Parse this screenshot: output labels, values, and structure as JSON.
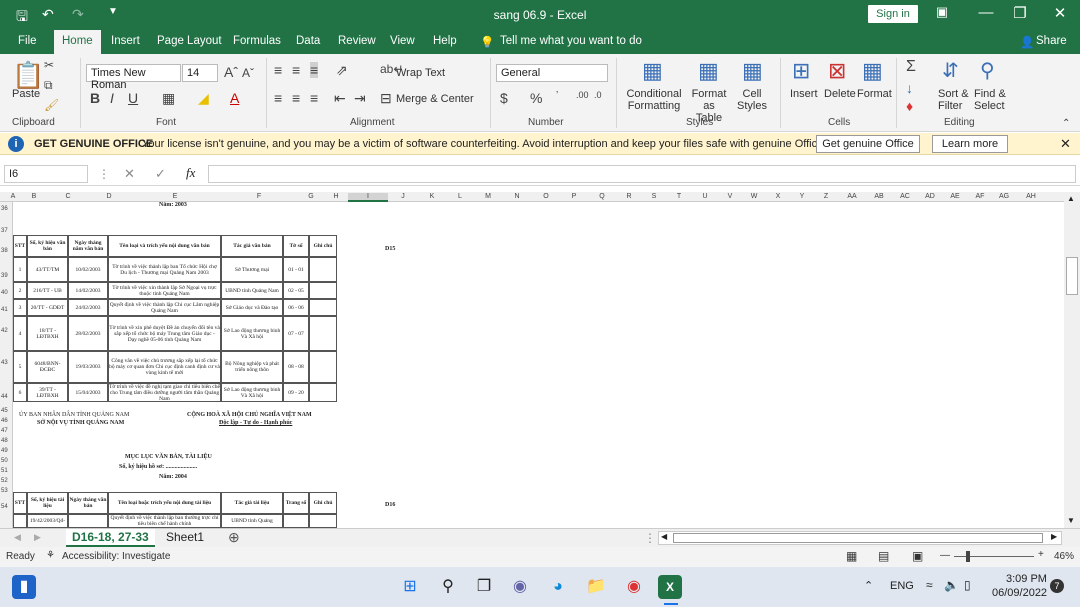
{
  "window": {
    "title": "sang 06.9  -  Excel",
    "sign_in": "Sign in"
  },
  "ribbon_tabs": [
    "File",
    "Home",
    "Insert",
    "Page Layout",
    "Formulas",
    "Data",
    "Review",
    "View",
    "Help"
  ],
  "tell_me": "Tell me what you want to do",
  "share": "Share",
  "ribbon": {
    "paste": "Paste",
    "clipboard": "Clipboard",
    "font_name": "Times New Roman",
    "font_size": "14",
    "font": "Font",
    "wrap_text": "Wrap Text",
    "merge_center": "Merge & Center",
    "alignment": "Alignment",
    "number_format": "General",
    "number": "Number",
    "conditional_formatting": [
      "Conditional",
      "Formatting"
    ],
    "format_as_table": [
      "Format as",
      "Table"
    ],
    "cell_styles": [
      "Cell",
      "Styles"
    ],
    "styles": "Styles",
    "insert": "Insert",
    "delete": "Delete",
    "format": "Format",
    "cells": "Cells",
    "sort_filter": [
      "Sort &",
      "Filter"
    ],
    "find_select": [
      "Find &",
      "Select"
    ],
    "editing": "Editing"
  },
  "message_bar": {
    "title": "GET GENUINE OFFICE",
    "text": "Your license isn't genuine, and you may be a victim of software counterfeiting. Avoid interruption and keep your files safe with genuine Office today.",
    "btn1": "Get genuine Office",
    "btn2": "Learn more"
  },
  "formula_bar": {
    "name_box": "I6",
    "formula": ""
  },
  "columns": [
    "A",
    "B",
    "C",
    "D",
    "E",
    "F",
    "G",
    "H",
    "I",
    "J",
    "K",
    "L",
    "M",
    "N",
    "O",
    "P",
    "Q",
    "R",
    "S",
    "T",
    "U",
    "V",
    "W",
    "X",
    "Y",
    "Z",
    "AA",
    "AB",
    "AC",
    "AD",
    "AE",
    "AF",
    "AG",
    "AH"
  ],
  "rows": [
    "36",
    "37",
    "38",
    "39",
    "40",
    "41",
    "42",
    "43",
    "44",
    "45",
    "46",
    "47",
    "48",
    "49",
    "50",
    "51",
    "52",
    "53",
    "54"
  ],
  "sheet": {
    "year_2003": "Năm: 2003",
    "headers": [
      "STT",
      "Số, ký hiệu văn bản",
      "Ngày tháng năm văn bản",
      "Tên loại và trích yếu nội dung văn bản",
      "Tác giả văn bản",
      "Tờ số",
      "Ghi chú"
    ],
    "d15": "D15",
    "records": [
      [
        "1",
        "43/TT/TM",
        "10/02/2003",
        "Tờ trình về việc thành lập ban Tổ chức Hội chợ Du lịch - Thương mại Quảng Nam 2003",
        "Sở Thương mại",
        "01 - 01",
        ""
      ],
      [
        "2",
        "216/TT - UB",
        "14/02/2003",
        "Tờ trình về việc xin thành lập Sở Ngoại vụ trực thuộc tỉnh Quảng Nam",
        "UBND tỉnh Quảng Nam",
        "02 - 05",
        ""
      ],
      [
        "3",
        "20/TT - GDĐT",
        "24/02/2003",
        "Quyết định về việc thành lập Chi cục Lâm nghiệp Quảng Nam",
        "Sở Giáo dục và Đào tạo",
        "06 - 06",
        ""
      ],
      [
        "4",
        "18/TT - LĐTBXH",
        "28/02/2003",
        "Tờ trình về xin phê duyệt Đề án chuyển đổi tên và sắp xếp tổ chức bộ máy Trung tâm Giáo dục - Dạy nghề 05-06 tỉnh Quảng Nam",
        "Sở Lao động thương binh Và Xã hội",
        "07 - 07",
        ""
      ],
      [
        "5",
        "6048/BNN-ĐCĐC",
        "19/03/2003",
        "Công văn về việc chủ trương sắp xếp lại tổ chức bộ máy cơ quan đơn Chi cục định canh định cư và vùng kinh tế mới",
        "Bộ Nông nghiệp và phát triển nông thôn",
        "08 - 08",
        ""
      ],
      [
        "6",
        "39/TT - LĐTBXH",
        "15/04/2003",
        "Tờ trình về việc đề nghị tạm giao chỉ tiêu biên chế cho Trung tâm điều dưỡng người tâm thần Quảng Nam",
        "Sở Lao động thương binh Và Xã hội",
        "09 - 20",
        ""
      ]
    ],
    "left_header": [
      "ỦY BAN NHÂN DÂN TỈNH QUẢNG NAM",
      "SỞ NỘI VỤ TỈNH QUẢNG NAM"
    ],
    "right_header": [
      "CỘNG HOÀ XÃ HỘI CHỦ NGHĨA VIỆT NAM",
      "Độc lập - Tự do - Hạnh phúc"
    ],
    "catalog_title": "MỤC LỤC VĂN BẢN, TÀI LIỆU",
    "file_no": "Số, ký hiệu hồ sơ: .....................",
    "year_2004": "Năm: 2004",
    "headers2": [
      "STT",
      "Số, ký hiệu tài liệu",
      "Ngày tháng văn bản",
      "Tên loại hoặc trích yếu nội dung tài liệu",
      "Tác giả tài liệu",
      "Trang số",
      "Ghi chú"
    ],
    "d16": "D16",
    "partial_row": [
      "",
      "19/42/2003/Qđ-",
      "",
      "Quyết định về việc thành lập ban thường trực chỉ tiêu biên chế hành chính",
      "UBND tỉnh Quảng",
      "",
      ""
    ]
  },
  "sheet_tabs": [
    "D16-18, 27-33",
    "Sheet1"
  ],
  "status": {
    "ready": "Ready",
    "accessibility": "Accessibility: Investigate",
    "zoom": "46%"
  },
  "taskbar": {
    "lang": "ENG",
    "time": "3:09 PM",
    "date": "06/09/2022",
    "badge": "7"
  }
}
